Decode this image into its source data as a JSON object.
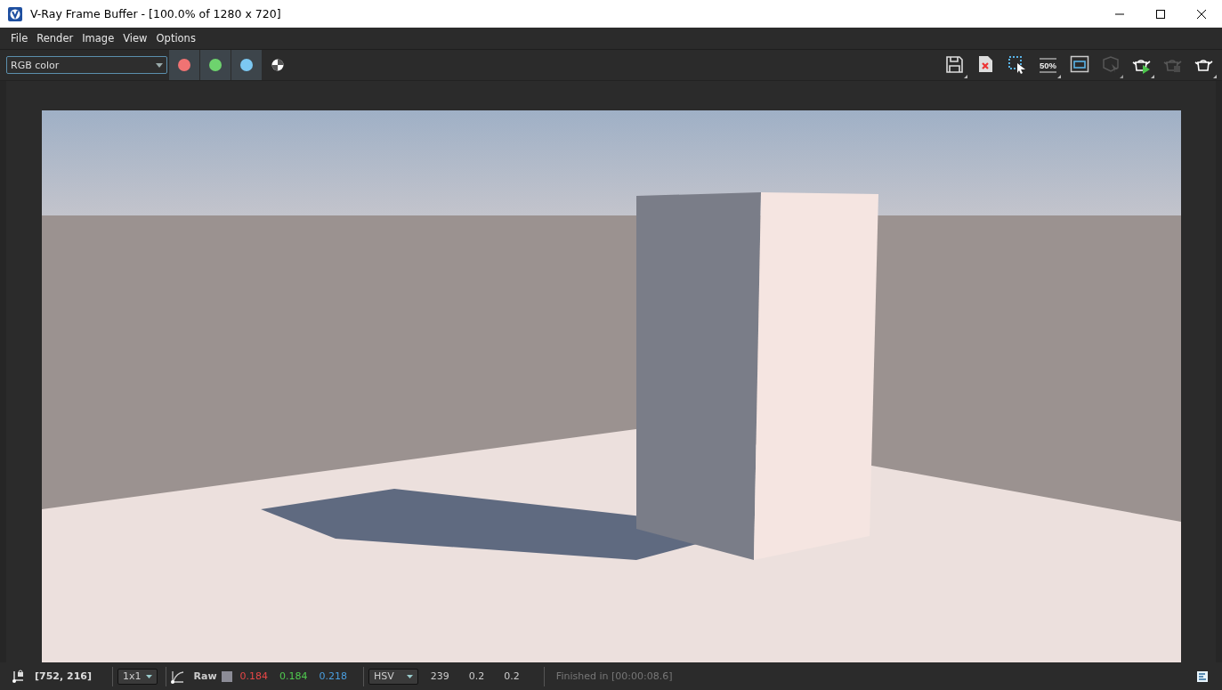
{
  "window": {
    "title": "V-Ray Frame Buffer - [100.0% of 1280 x 720]"
  },
  "menu": [
    "File",
    "Render",
    "Image",
    "View",
    "Options"
  ],
  "channel_dropdown": {
    "value": "RGB color"
  },
  "channel_toggles": [
    {
      "kind": "red",
      "color": "#f07373",
      "on": true
    },
    {
      "kind": "green",
      "color": "#6ed36e",
      "on": true
    },
    {
      "kind": "blue",
      "color": "#7cc8f2",
      "on": true
    },
    {
      "kind": "mono",
      "color": "#ffffff",
      "on": false
    }
  ],
  "tools": [
    {
      "kind": "save",
      "has_menu": true,
      "disabled": false
    },
    {
      "kind": "clear",
      "has_menu": false,
      "disabled": false
    },
    {
      "kind": "region",
      "has_menu": false,
      "disabled": false
    },
    {
      "kind": "zoom",
      "label": "50%",
      "has_menu": true,
      "disabled": false
    },
    {
      "kind": "frame",
      "has_menu": false,
      "disabled": false
    },
    {
      "kind": "cube",
      "has_menu": true,
      "disabled": true
    },
    {
      "kind": "render",
      "has_menu": true,
      "disabled": false
    },
    {
      "kind": "stop",
      "has_menu": false,
      "disabled": true
    },
    {
      "kind": "teapot",
      "has_menu": true,
      "disabled": false
    }
  ],
  "status_bar": {
    "coords": "[752, 216]",
    "sample_size": "1x1",
    "mode": "Raw",
    "values": [
      {
        "text": "0.184",
        "color": "#e64646"
      },
      {
        "text": "0.184",
        "color": "#4fc94f"
      },
      {
        "text": "0.218",
        "color": "#4a9fe0"
      }
    ],
    "color_space": "HSV",
    "space_values": [
      "239",
      "0.2",
      "0.2"
    ],
    "message": "Finished in [00:00:08.6]"
  }
}
